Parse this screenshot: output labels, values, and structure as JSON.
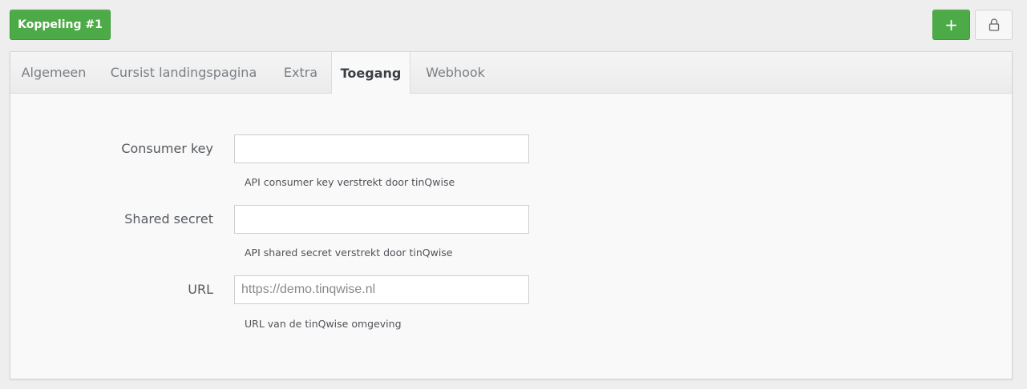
{
  "header": {
    "title_button": "Koppeling #1",
    "add_button": "+"
  },
  "tabs": [
    {
      "label": "Algemeen",
      "active": false
    },
    {
      "label": "Cursist landingspagina",
      "active": false
    },
    {
      "label": "Extra",
      "active": false
    },
    {
      "label": "Toegang",
      "active": true
    },
    {
      "label": "Webhook",
      "active": false
    }
  ],
  "form": {
    "consumer_key": {
      "label": "Consumer key",
      "value": "",
      "help": "API consumer key verstrekt door tinQwise"
    },
    "shared_secret": {
      "label": "Shared secret",
      "value": "",
      "help": "API shared secret verstrekt door tinQwise"
    },
    "url": {
      "label": "URL",
      "value": "",
      "placeholder": "https://demo.tinqwise.nl",
      "help": "URL van de tinQwise omgeving"
    }
  },
  "colors": {
    "accent": "#4caa47",
    "background": "#eeeeee"
  },
  "icons": {
    "add": "plus-icon",
    "lock": "lock-icon"
  }
}
